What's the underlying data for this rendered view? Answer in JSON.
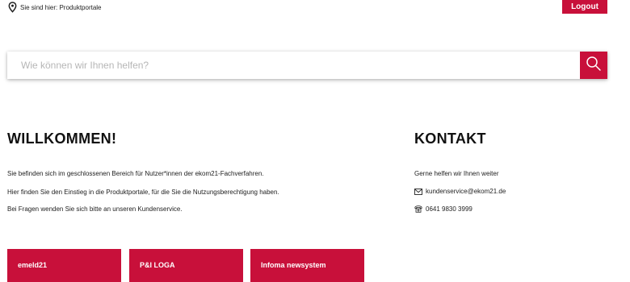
{
  "breadcrumb": {
    "icon": "location-pin-icon",
    "text": "Sie sind hier: Produktportale"
  },
  "header": {
    "logout_label": "Logout"
  },
  "search": {
    "placeholder": "Wie können wir Ihnen helfen?",
    "value": "",
    "icon": "search-icon"
  },
  "welcome": {
    "title": "WILLKOMMEN!",
    "lines": [
      "Sie befinden sich im geschlossenen Bereich für Nutzer*innen der ekom21-Fachverfahren.",
      "Hier finden Sie den Einstieg in die Produktportale, für die Sie die Nutzungsberechtigung haben.",
      "Bei Fragen wenden Sie sich bitte an unseren Kundenservice."
    ]
  },
  "contact": {
    "title": "KONTAKT",
    "intro": "Gerne helfen wir Ihnen weiter",
    "email": "kundenservice@ekom21.de",
    "email_icon": "envelope-icon",
    "phone": "0641 9830 3999",
    "phone_icon": "phone-icon"
  },
  "tiles": [
    {
      "label": "emeld21"
    },
    {
      "label": "P&I LOGA"
    },
    {
      "label": "Infoma newsystem"
    }
  ],
  "colors": {
    "accent": "#c8103a",
    "text": "#1a1a1a",
    "placeholder": "#b6b6b6"
  }
}
